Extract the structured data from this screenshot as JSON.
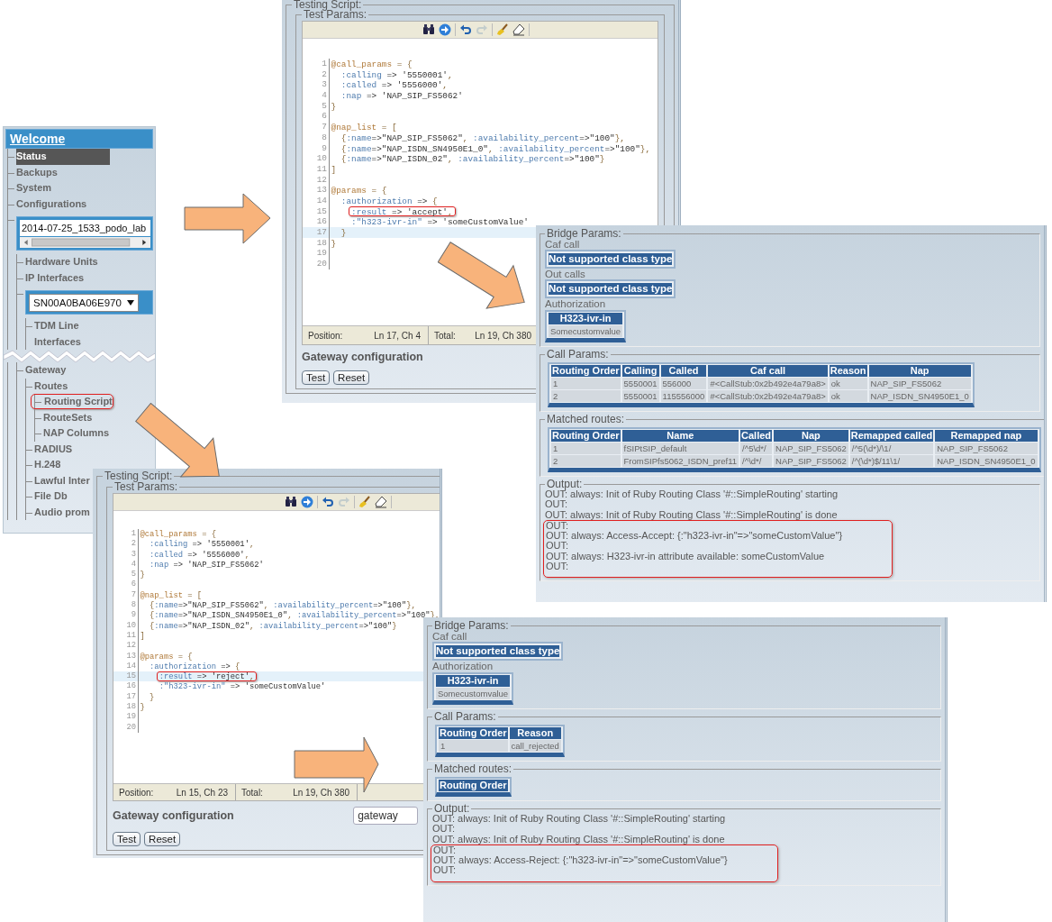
{
  "sidebar": {
    "title": "Welcome",
    "items": [
      {
        "label": "Status",
        "selected": true
      },
      {
        "label": "Backups",
        "selected": false
      },
      {
        "label": "System",
        "selected": false
      },
      {
        "label": "Configurations",
        "selected": false
      },
      {
        "kind": "listbox",
        "value": "2014-07-25_1533_podo_lab",
        "children": [
          {
            "label": "Hardware Units",
            "selected": false
          },
          {
            "label": "IP Interfaces",
            "selected": false
          },
          {
            "kind": "select",
            "value": "SN00A0BA06E970",
            "children": [
              {
                "label": "TDM Line Interfaces",
                "selected": false
              }
            ]
          },
          {
            "kind": "break"
          },
          {
            "label": "Gateway",
            "selected": false,
            "children": [
              {
                "label": "Routes",
                "selected": false,
                "children": [
                  {
                    "label": "Routing Script",
                    "selected": false,
                    "annotated": true
                  },
                  {
                    "label": "RouteSets",
                    "selected": false
                  },
                  {
                    "label": "NAP Columns",
                    "selected": false
                  }
                ]
              },
              {
                "label": "RADIUS",
                "selected": false
              },
              {
                "label": "H.248",
                "selected": false
              },
              {
                "label": "Lawful Inter",
                "selected": false
              },
              {
                "label": "File Db",
                "selected": false
              },
              {
                "label": "Audio prom",
                "selected": false
              }
            ]
          }
        ]
      }
    ]
  },
  "testing_scripts": [
    {
      "legend": "Testing Script:",
      "params_legend": "Test Params:",
      "toolbar": [
        {
          "kind": "find",
          "disabled": false
        },
        {
          "kind": "go",
          "disabled": false
        },
        {
          "kind": "undo",
          "disabled": false
        },
        {
          "kind": "redo",
          "disabled": true
        },
        {
          "kind": "highlight",
          "disabled": false
        },
        {
          "kind": "eraser",
          "disabled": false
        }
      ],
      "code_lines": [
        {
          "number": "1",
          "code": "@call_params = {",
          "current": false,
          "annotated": false
        },
        {
          "number": "2",
          "code": "  :calling => '5550001',",
          "current": false,
          "annotated": false
        },
        {
          "number": "3",
          "code": "  :called => '5556000',",
          "current": false,
          "annotated": false
        },
        {
          "number": "4",
          "code": "  :nap => 'NAP_SIP_FS5062'",
          "current": false,
          "annotated": false
        },
        {
          "number": "5",
          "code": "}",
          "current": false,
          "annotated": false
        },
        {
          "number": "6",
          "current": false
        },
        {
          "number": "7",
          "code": "@nap_list = [",
          "current": false,
          "annotated": false
        },
        {
          "number": "8",
          "code": "  {:name=>\"NAP_SIP_FS5062\", :availability_percent=>\"100\"},",
          "current": false,
          "annotated": false
        },
        {
          "number": "9",
          "code": "  {:name=>\"NAP_ISDN_SN4950E1_0\", :availability_percent=>\"100\"},",
          "current": false,
          "annotated": false
        },
        {
          "number": "10",
          "code": "  {:name=>\"NAP_ISDN_02\", :availability_percent=>\"100\"}",
          "current": false,
          "annotated": false
        },
        {
          "number": "11",
          "code": "]",
          "current": false,
          "annotated": false
        },
        {
          "number": "12",
          "current": false
        },
        {
          "number": "13",
          "code": "@params = {",
          "current": false,
          "annotated": false
        },
        {
          "number": "14",
          "code": "  :authorization => {",
          "current": false,
          "annotated": false
        },
        {
          "number": "15",
          "code": "    :result => 'accept',",
          "current": false,
          "annotated": true
        },
        {
          "number": "16",
          "code": "    :\"h323-ivr-in\" => 'someCustomValue'",
          "current": false,
          "annotated": false
        },
        {
          "number": "17",
          "code": "  }",
          "current": true,
          "annotated": false
        },
        {
          "number": "18",
          "code": "}",
          "current": false,
          "annotated": false
        },
        {
          "number": "19",
          "current": false
        },
        {
          "number": "20",
          "current": false
        }
      ],
      "status": {
        "position_label": "Position:",
        "position": "Ln 17, Ch 4",
        "total_label": "Total:",
        "total": "Ln 19, Ch 380"
      },
      "section_title": "Gateway configuration",
      "buttons": [
        "Test",
        "Reset"
      ]
    },
    {
      "legend": "Testing Script:",
      "params_legend": "Test Params:",
      "toolbar": [
        {
          "kind": "find",
          "disabled": false
        },
        {
          "kind": "go",
          "disabled": false
        },
        {
          "kind": "undo",
          "disabled": false
        },
        {
          "kind": "redo",
          "disabled": true
        },
        {
          "kind": "highlight",
          "disabled": false
        },
        {
          "kind": "eraser",
          "disabled": false
        }
      ],
      "code_lines": [
        {
          "number": "1",
          "code": "@call_params = {",
          "current": false,
          "annotated": false
        },
        {
          "number": "2",
          "code": "  :calling => '5550001',",
          "current": false,
          "annotated": false
        },
        {
          "number": "3",
          "code": "  :called => '5556000',",
          "current": false,
          "annotated": false
        },
        {
          "number": "4",
          "code": "  :nap => 'NAP_SIP_FS5062'",
          "current": false,
          "annotated": false
        },
        {
          "number": "5",
          "code": "}",
          "current": false,
          "annotated": false
        },
        {
          "number": "6",
          "current": false
        },
        {
          "number": "7",
          "code": "@nap_list = [",
          "current": false,
          "annotated": false
        },
        {
          "number": "8",
          "code": "  {:name=>\"NAP_SIP_FS5062\", :availability_percent=>\"100\"},",
          "current": false,
          "annotated": false
        },
        {
          "number": "9",
          "code": "  {:name=>\"NAP_ISDN_SN4950E1_0\", :availability_percent=>\"100\"},",
          "current": false,
          "annotated": false
        },
        {
          "number": "10",
          "code": "  {:name=>\"NAP_ISDN_02\", :availability_percent=>\"100\"}",
          "current": false,
          "annotated": false
        },
        {
          "number": "11",
          "code": "]",
          "current": false,
          "annotated": false
        },
        {
          "number": "12",
          "current": false
        },
        {
          "number": "13",
          "code": "@params = {",
          "current": false,
          "annotated": false
        },
        {
          "number": "14",
          "code": "  :authorization => {",
          "current": false,
          "annotated": false
        },
        {
          "number": "15",
          "code": "    :result => 'reject',",
          "current": true,
          "annotated": true
        },
        {
          "number": "16",
          "code": "    :\"h323-ivr-in\" => 'someCustomValue'",
          "current": false,
          "annotated": false
        },
        {
          "number": "17",
          "code": "  }",
          "current": false,
          "annotated": false
        },
        {
          "number": "18",
          "code": "}",
          "current": false,
          "annotated": false
        },
        {
          "number": "19",
          "current": false
        },
        {
          "number": "20",
          "current": false
        }
      ],
      "status": {
        "position_label": "Position:",
        "position": "Ln 15, Ch 23",
        "total_label": "Total:",
        "total": "Ln 19, Ch 380"
      },
      "section_title": "Gateway configuration",
      "gateway_field": {
        "value": "gateway"
      },
      "buttons": [
        "Test",
        "Reset"
      ]
    }
  ],
  "results": [
    {
      "bridge": {
        "legend": "Bridge Params:",
        "items": [
          {
            "kind": "box",
            "label": "Caf call",
            "value": "Not supported class type"
          },
          {
            "kind": "box",
            "label": "Out calls",
            "value": "Not supported class type"
          },
          {
            "kind": "table",
            "label": "Authorization",
            "columns": [
              "H323-ivr-in"
            ],
            "rows": [
              [
                "Somecustomvalue"
              ]
            ]
          }
        ]
      },
      "call_params": {
        "legend": "Call Params:",
        "columns": [
          "Routing Order",
          "Calling",
          "Called",
          "Caf call",
          "Reason",
          "Nap"
        ],
        "rows": [
          [
            "1",
            "5550001",
            "556000",
            "#<CallStub:0x2b492e4a79a8>",
            "ok",
            "NAP_SIP_FS5062"
          ],
          [
            "2",
            "5550001",
            "115556000",
            "#<CallStub:0x2b492e4a79a8>",
            "ok",
            "NAP_ISDN_SN4950E1_0"
          ]
        ]
      },
      "matched_routes": {
        "legend": "Matched routes:",
        "columns": [
          "Routing Order",
          "Name",
          "Called",
          "Nap",
          "Remapped called",
          "Remapped nap"
        ],
        "rows": [
          [
            "1",
            "fSIPtSIP_default",
            "/^5\\d*/",
            "NAP_SIP_FS5062",
            "/^5(\\d*)/\\1/",
            "NAP_SIP_FS5062"
          ],
          [
            "2",
            "FromSIPfs5062_ISDN_pref11",
            "/^\\d*/",
            "NAP_SIP_FS5062",
            "/^(\\d*)$/11\\1/",
            "NAP_ISDN_SN4950E1_0"
          ]
        ]
      },
      "output": {
        "legend": "Output:",
        "lines": [
          "OUT: always: Init of Ruby Routing Class '#::SimpleRouting' starting",
          "OUT:",
          "OUT: always: Init of Ruby Routing Class '#::SimpleRouting' is done"
        ],
        "highlighted_lines": [
          "OUT:",
          "OUT: always: Access-Accept: {:\"h323-ivr-in\"=>\"someCustomValue\"}",
          "OUT:",
          "OUT: always: H323-ivr-in attribute available: someCustomValue",
          "OUT:"
        ]
      }
    },
    {
      "bridge": {
        "legend": "Bridge Params:",
        "items": [
          {
            "kind": "box",
            "label": "Caf call",
            "value": "Not supported class type"
          },
          {
            "kind": "table",
            "label": "Authorization",
            "columns": [
              "H323-ivr-in"
            ],
            "rows": [
              [
                "Somecustomvalue"
              ]
            ]
          }
        ]
      },
      "call_params": {
        "legend": "Call Params:",
        "columns": [
          "Routing Order",
          "Reason"
        ],
        "rows": [
          [
            "1",
            "call_rejected"
          ]
        ]
      },
      "matched_routes": {
        "legend": "Matched routes:",
        "columns": [
          "Routing Order"
        ]
      },
      "output": {
        "legend": "Output:",
        "lines": [
          "OUT: always: Init of Ruby Routing Class '#::SimpleRouting' starting",
          "OUT:",
          "OUT: always: Init of Ruby Routing Class '#::SimpleRouting' is done"
        ],
        "highlighted_lines": [
          "OUT:",
          "OUT: always: Access-Reject: {:\"h323-ivr-in\"=>\"someCustomValue\"}",
          "OUT:"
        ]
      }
    }
  ]
}
